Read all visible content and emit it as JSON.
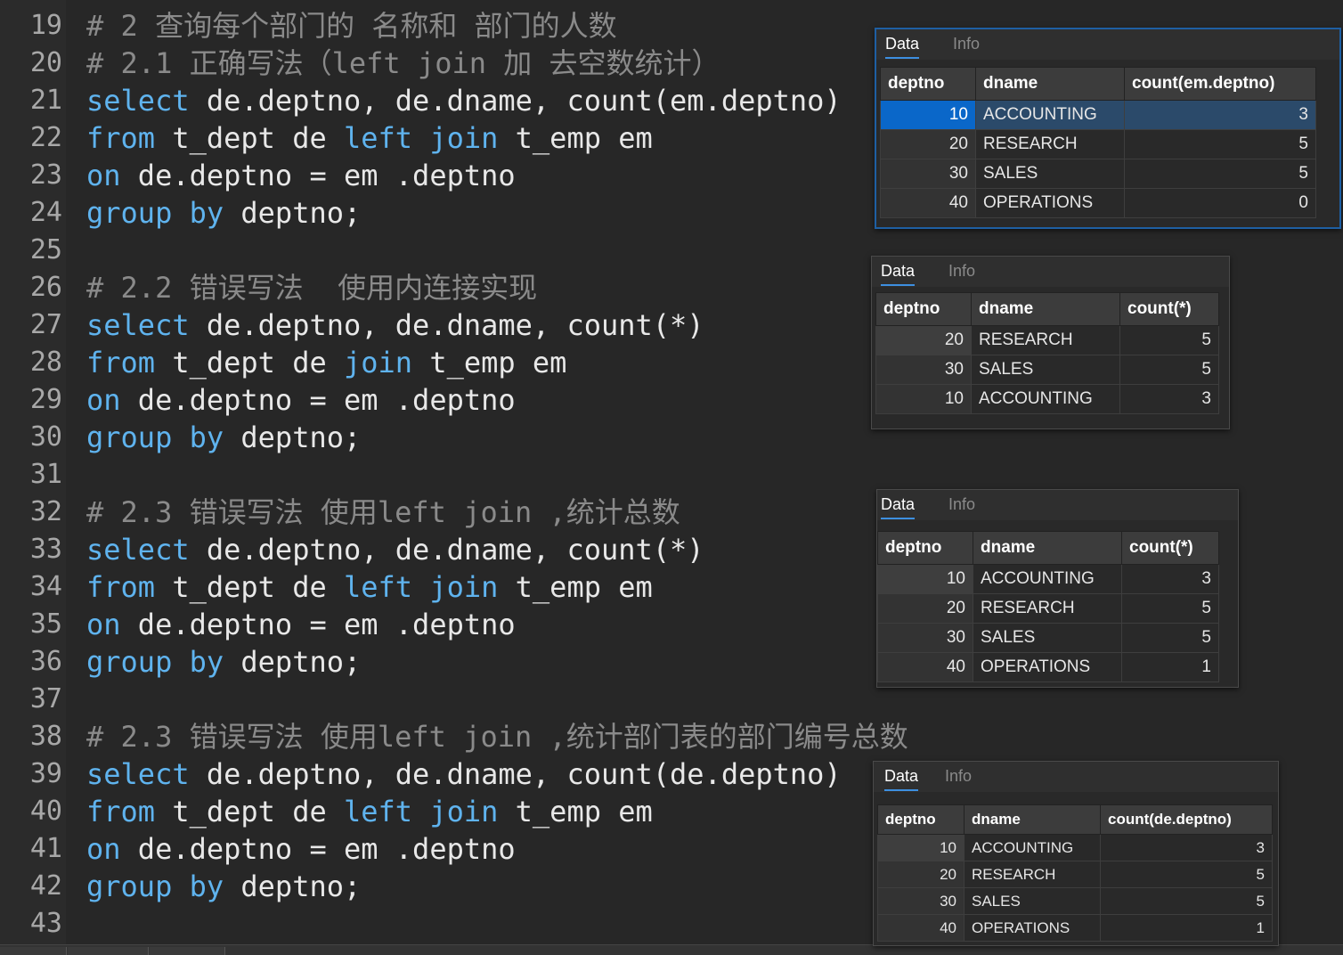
{
  "editor": {
    "lines": [
      {
        "no": "19",
        "tokens": [
          {
            "t": "# 2 查询每个部门的 名称和 部门的人数",
            "c": "cm"
          }
        ]
      },
      {
        "no": "20",
        "tokens": [
          {
            "t": "# 2.1 正确写法（left join 加 去空数统计）",
            "c": "cm"
          }
        ]
      },
      {
        "no": "21",
        "tokens": [
          {
            "t": "select",
            "c": "kw"
          },
          {
            "t": " de.deptno, de.dname, count(em.deptno)",
            "c": ""
          }
        ]
      },
      {
        "no": "22",
        "tokens": [
          {
            "t": "from",
            "c": "kw"
          },
          {
            "t": " t_dept de ",
            "c": ""
          },
          {
            "t": "left join",
            "c": "kw"
          },
          {
            "t": " t_emp em",
            "c": ""
          }
        ]
      },
      {
        "no": "23",
        "tokens": [
          {
            "t": "on",
            "c": "kw"
          },
          {
            "t": " de.deptno = em .deptno",
            "c": ""
          }
        ]
      },
      {
        "no": "24",
        "tokens": [
          {
            "t": "group by",
            "c": "kw"
          },
          {
            "t": " deptno;",
            "c": ""
          }
        ]
      },
      {
        "no": "25",
        "tokens": []
      },
      {
        "no": "26",
        "tokens": [
          {
            "t": "# 2.2 错误写法  使用内连接实现",
            "c": "cm"
          }
        ]
      },
      {
        "no": "27",
        "tokens": [
          {
            "t": "select",
            "c": "kw"
          },
          {
            "t": " de.deptno, de.dname, count(*)",
            "c": ""
          }
        ]
      },
      {
        "no": "28",
        "tokens": [
          {
            "t": "from",
            "c": "kw"
          },
          {
            "t": " t_dept de ",
            "c": ""
          },
          {
            "t": "join",
            "c": "kw"
          },
          {
            "t": " t_emp em",
            "c": ""
          }
        ]
      },
      {
        "no": "29",
        "tokens": [
          {
            "t": "on",
            "c": "kw"
          },
          {
            "t": " de.deptno = em .deptno",
            "c": ""
          }
        ]
      },
      {
        "no": "30",
        "tokens": [
          {
            "t": "group by",
            "c": "kw"
          },
          {
            "t": " deptno;",
            "c": ""
          }
        ]
      },
      {
        "no": "31",
        "tokens": []
      },
      {
        "no": "32",
        "tokens": [
          {
            "t": "# 2.3 错误写法 使用left join ,统计总数",
            "c": "cm"
          }
        ]
      },
      {
        "no": "33",
        "tokens": [
          {
            "t": "select",
            "c": "kw"
          },
          {
            "t": " de.deptno, de.dname, count(*)",
            "c": ""
          }
        ]
      },
      {
        "no": "34",
        "tokens": [
          {
            "t": "from",
            "c": "kw"
          },
          {
            "t": " t_dept de ",
            "c": ""
          },
          {
            "t": "left join",
            "c": "kw"
          },
          {
            "t": " t_emp em",
            "c": ""
          }
        ]
      },
      {
        "no": "35",
        "tokens": [
          {
            "t": "on",
            "c": "kw"
          },
          {
            "t": " de.deptno = em .deptno",
            "c": ""
          }
        ]
      },
      {
        "no": "36",
        "tokens": [
          {
            "t": "group by",
            "c": "kw"
          },
          {
            "t": " deptno;",
            "c": ""
          }
        ]
      },
      {
        "no": "37",
        "tokens": []
      },
      {
        "no": "38",
        "tokens": [
          {
            "t": "# 2.3 错误写法 使用left join ,统计部门表的部门编号总数",
            "c": "cm"
          }
        ]
      },
      {
        "no": "39",
        "tokens": [
          {
            "t": "select",
            "c": "kw"
          },
          {
            "t": " de.deptno, de.dname, count(de.deptno)",
            "c": ""
          }
        ]
      },
      {
        "no": "40",
        "tokens": [
          {
            "t": "from",
            "c": "kw"
          },
          {
            "t": " t_dept de ",
            "c": ""
          },
          {
            "t": "left join",
            "c": "kw"
          },
          {
            "t": " t_emp em",
            "c": ""
          }
        ]
      },
      {
        "no": "41",
        "tokens": [
          {
            "t": "on",
            "c": "kw"
          },
          {
            "t": " de.deptno = em .deptno",
            "c": ""
          }
        ]
      },
      {
        "no": "42",
        "tokens": [
          {
            "t": "group by",
            "c": "kw"
          },
          {
            "t": " deptno;",
            "c": ""
          }
        ]
      },
      {
        "no": "43",
        "tokens": []
      }
    ]
  },
  "panels": [
    {
      "tabs": [
        "Data",
        "Info"
      ],
      "headers": [
        "deptno",
        "dname",
        "count(em.deptno)"
      ],
      "rows": [
        [
          "10",
          "ACCOUNTING",
          "3"
        ],
        [
          "20",
          "RESEARCH",
          "5"
        ],
        [
          "30",
          "SALES",
          "5"
        ],
        [
          "40",
          "OPERATIONS",
          "0"
        ]
      ],
      "selected_row": 0
    },
    {
      "tabs": [
        "Data",
        "Info"
      ],
      "headers": [
        "deptno",
        "dname",
        "count(*)"
      ],
      "rows": [
        [
          "20",
          "RESEARCH",
          "5"
        ],
        [
          "30",
          "SALES",
          "5"
        ],
        [
          "10",
          "ACCOUNTING",
          "3"
        ]
      ],
      "selected_row": -1
    },
    {
      "tabs": [
        "Data",
        "Info"
      ],
      "headers": [
        "deptno",
        "dname",
        "count(*)"
      ],
      "rows": [
        [
          "10",
          "ACCOUNTING",
          "3"
        ],
        [
          "20",
          "RESEARCH",
          "5"
        ],
        [
          "30",
          "SALES",
          "5"
        ],
        [
          "40",
          "OPERATIONS",
          "1"
        ]
      ],
      "selected_row": -1
    },
    {
      "tabs": [
        "Data",
        "Info"
      ],
      "headers": [
        "deptno",
        "dname",
        "count(de.deptno)"
      ],
      "rows": [
        [
          "10",
          "ACCOUNTING",
          "3"
        ],
        [
          "20",
          "RESEARCH",
          "5"
        ],
        [
          "30",
          "SALES",
          "5"
        ],
        [
          "40",
          "OPERATIONS",
          "1"
        ]
      ],
      "selected_row": -1
    }
  ]
}
